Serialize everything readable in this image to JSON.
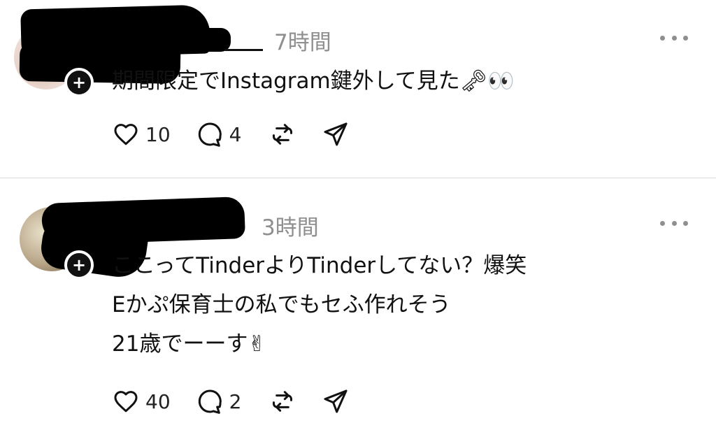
{
  "posts": [
    {
      "timestamp": "7時間",
      "text_lines": [
        "期間限定でInstagram鍵外して見た🗝👀"
      ],
      "likes": "10",
      "replies": "4",
      "follow_label": "+"
    },
    {
      "timestamp": "3時間",
      "text_lines": [
        "ここってTinderよりTinderしてない？爆笑",
        "Eかぷ保育士の私でもセふ作れそう",
        "21歳でーーす✌"
      ],
      "likes": "40",
      "replies": "2",
      "follow_label": "+"
    }
  ],
  "icons": {
    "like": "heart-icon",
    "reply": "comment-icon",
    "repost": "repost-icon",
    "share": "send-icon",
    "more": "more-dots-icon"
  },
  "colors": {
    "text": "#111111",
    "muted": "#8f8f8f",
    "divider": "#d9d9d9"
  }
}
